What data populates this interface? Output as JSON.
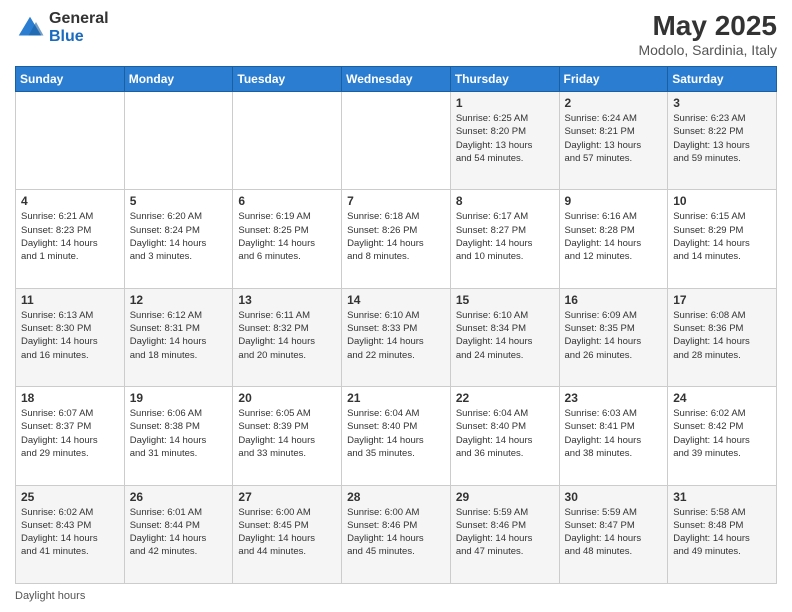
{
  "header": {
    "logo_general": "General",
    "logo_blue": "Blue",
    "title": "May 2025",
    "subtitle": "Modolo, Sardinia, Italy"
  },
  "days_of_week": [
    "Sunday",
    "Monday",
    "Tuesday",
    "Wednesday",
    "Thursday",
    "Friday",
    "Saturday"
  ],
  "footer": {
    "daylight_label": "Daylight hours"
  },
  "weeks": [
    [
      {
        "day": "",
        "info": ""
      },
      {
        "day": "",
        "info": ""
      },
      {
        "day": "",
        "info": ""
      },
      {
        "day": "",
        "info": ""
      },
      {
        "day": "1",
        "info": "Sunrise: 6:25 AM\nSunset: 8:20 PM\nDaylight: 13 hours\nand 54 minutes."
      },
      {
        "day": "2",
        "info": "Sunrise: 6:24 AM\nSunset: 8:21 PM\nDaylight: 13 hours\nand 57 minutes."
      },
      {
        "day": "3",
        "info": "Sunrise: 6:23 AM\nSunset: 8:22 PM\nDaylight: 13 hours\nand 59 minutes."
      }
    ],
    [
      {
        "day": "4",
        "info": "Sunrise: 6:21 AM\nSunset: 8:23 PM\nDaylight: 14 hours\nand 1 minute."
      },
      {
        "day": "5",
        "info": "Sunrise: 6:20 AM\nSunset: 8:24 PM\nDaylight: 14 hours\nand 3 minutes."
      },
      {
        "day": "6",
        "info": "Sunrise: 6:19 AM\nSunset: 8:25 PM\nDaylight: 14 hours\nand 6 minutes."
      },
      {
        "day": "7",
        "info": "Sunrise: 6:18 AM\nSunset: 8:26 PM\nDaylight: 14 hours\nand 8 minutes."
      },
      {
        "day": "8",
        "info": "Sunrise: 6:17 AM\nSunset: 8:27 PM\nDaylight: 14 hours\nand 10 minutes."
      },
      {
        "day": "9",
        "info": "Sunrise: 6:16 AM\nSunset: 8:28 PM\nDaylight: 14 hours\nand 12 minutes."
      },
      {
        "day": "10",
        "info": "Sunrise: 6:15 AM\nSunset: 8:29 PM\nDaylight: 14 hours\nand 14 minutes."
      }
    ],
    [
      {
        "day": "11",
        "info": "Sunrise: 6:13 AM\nSunset: 8:30 PM\nDaylight: 14 hours\nand 16 minutes."
      },
      {
        "day": "12",
        "info": "Sunrise: 6:12 AM\nSunset: 8:31 PM\nDaylight: 14 hours\nand 18 minutes."
      },
      {
        "day": "13",
        "info": "Sunrise: 6:11 AM\nSunset: 8:32 PM\nDaylight: 14 hours\nand 20 minutes."
      },
      {
        "day": "14",
        "info": "Sunrise: 6:10 AM\nSunset: 8:33 PM\nDaylight: 14 hours\nand 22 minutes."
      },
      {
        "day": "15",
        "info": "Sunrise: 6:10 AM\nSunset: 8:34 PM\nDaylight: 14 hours\nand 24 minutes."
      },
      {
        "day": "16",
        "info": "Sunrise: 6:09 AM\nSunset: 8:35 PM\nDaylight: 14 hours\nand 26 minutes."
      },
      {
        "day": "17",
        "info": "Sunrise: 6:08 AM\nSunset: 8:36 PM\nDaylight: 14 hours\nand 28 minutes."
      }
    ],
    [
      {
        "day": "18",
        "info": "Sunrise: 6:07 AM\nSunset: 8:37 PM\nDaylight: 14 hours\nand 29 minutes."
      },
      {
        "day": "19",
        "info": "Sunrise: 6:06 AM\nSunset: 8:38 PM\nDaylight: 14 hours\nand 31 minutes."
      },
      {
        "day": "20",
        "info": "Sunrise: 6:05 AM\nSunset: 8:39 PM\nDaylight: 14 hours\nand 33 minutes."
      },
      {
        "day": "21",
        "info": "Sunrise: 6:04 AM\nSunset: 8:40 PM\nDaylight: 14 hours\nand 35 minutes."
      },
      {
        "day": "22",
        "info": "Sunrise: 6:04 AM\nSunset: 8:40 PM\nDaylight: 14 hours\nand 36 minutes."
      },
      {
        "day": "23",
        "info": "Sunrise: 6:03 AM\nSunset: 8:41 PM\nDaylight: 14 hours\nand 38 minutes."
      },
      {
        "day": "24",
        "info": "Sunrise: 6:02 AM\nSunset: 8:42 PM\nDaylight: 14 hours\nand 39 minutes."
      }
    ],
    [
      {
        "day": "25",
        "info": "Sunrise: 6:02 AM\nSunset: 8:43 PM\nDaylight: 14 hours\nand 41 minutes."
      },
      {
        "day": "26",
        "info": "Sunrise: 6:01 AM\nSunset: 8:44 PM\nDaylight: 14 hours\nand 42 minutes."
      },
      {
        "day": "27",
        "info": "Sunrise: 6:00 AM\nSunset: 8:45 PM\nDaylight: 14 hours\nand 44 minutes."
      },
      {
        "day": "28",
        "info": "Sunrise: 6:00 AM\nSunset: 8:46 PM\nDaylight: 14 hours\nand 45 minutes."
      },
      {
        "day": "29",
        "info": "Sunrise: 5:59 AM\nSunset: 8:46 PM\nDaylight: 14 hours\nand 47 minutes."
      },
      {
        "day": "30",
        "info": "Sunrise: 5:59 AM\nSunset: 8:47 PM\nDaylight: 14 hours\nand 48 minutes."
      },
      {
        "day": "31",
        "info": "Sunrise: 5:58 AM\nSunset: 8:48 PM\nDaylight: 14 hours\nand 49 minutes."
      }
    ]
  ]
}
